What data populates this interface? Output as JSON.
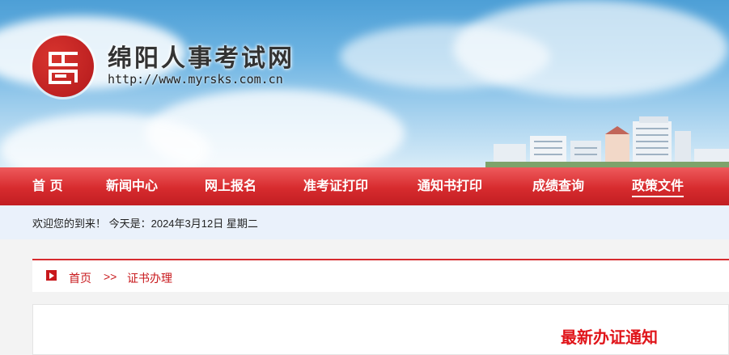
{
  "header": {
    "title": "绵阳人事考试网",
    "url": "http://www.myrsks.com.cn",
    "logo_color": "#c8181c"
  },
  "nav": {
    "items": [
      {
        "label": "首  页"
      },
      {
        "label": "新闻中心"
      },
      {
        "label": "网上报名"
      },
      {
        "label": "准考证打印"
      },
      {
        "label": "通知书打印"
      },
      {
        "label": "成绩查询"
      },
      {
        "label": "政策文件",
        "active": true
      }
    ],
    "color": "#d72b2e"
  },
  "welcome": {
    "text": "欢迎您的到来！  今天是：2024年3月12日 星期二"
  },
  "breadcrumb": {
    "home": "首页",
    "separator": ">>",
    "current": "证书办理"
  },
  "content": {
    "title": "最新办证通知",
    "title_color": "#e0151a"
  }
}
